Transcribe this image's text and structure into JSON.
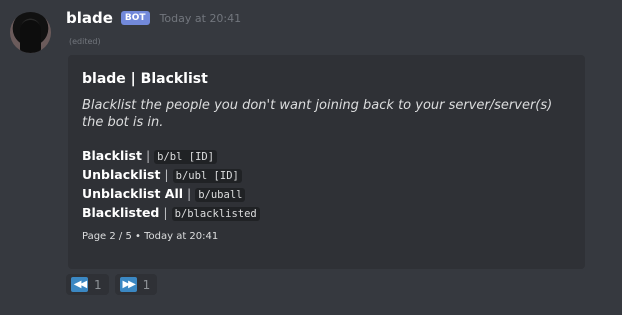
{
  "message": {
    "username": "blade",
    "bot_tag": "BOT",
    "timestamp": "Today at 20:41",
    "edited": "(edited)"
  },
  "embed": {
    "title": "blade | Blacklist",
    "description": "Blacklist the people you don't want joining back to your server/server(s) the bot is in.",
    "commands": [
      {
        "name": "Blacklist",
        "separator": "|",
        "usage": "b/bl [ID]"
      },
      {
        "name": "Unblacklist",
        "separator": "|",
        "usage": "b/ubl [ID]"
      },
      {
        "name": "Unblacklist All",
        "separator": "|",
        "usage": "b/uball"
      },
      {
        "name": "Blacklisted",
        "separator": "|",
        "usage": "b/blacklisted"
      }
    ],
    "footer": "Page 2 / 5 • Today at 20:41"
  },
  "reactions": [
    {
      "icon": "rewind-icon",
      "glyph": "◀◀",
      "count": "1"
    },
    {
      "icon": "fast-forward-icon",
      "glyph": "▶▶",
      "count": "1"
    }
  ],
  "colors": {
    "background": "#36393f",
    "embed_bg": "#2f3136",
    "bot_tag": "#7289da",
    "reaction_emoji": "#3b88c3"
  }
}
